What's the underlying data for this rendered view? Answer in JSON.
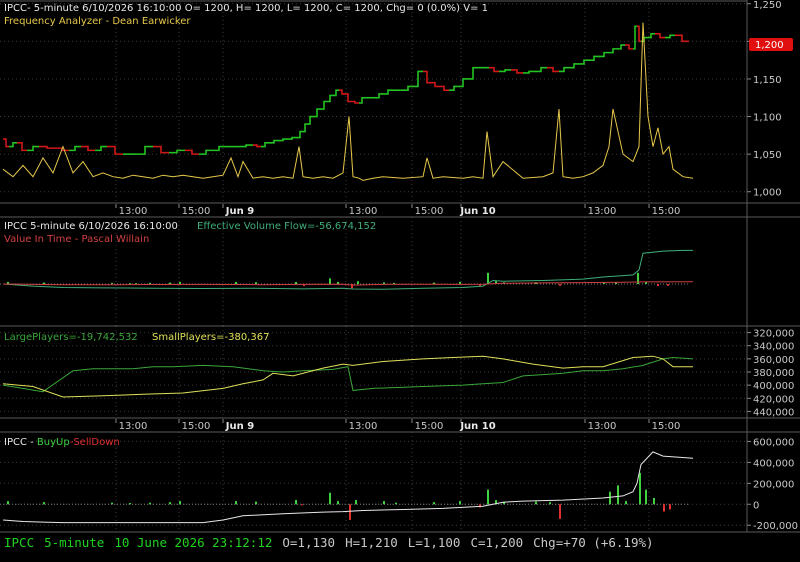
{
  "colors": {
    "background": "#000000",
    "grid": "#3a3a3a",
    "axis_text": "#c8c8c8",
    "up_candle": "#22c322",
    "down_candle": "#d01818",
    "frequency_line": "#e6c84a",
    "effective_volume_flow": "#3fae7a",
    "value_in_time": "#d04040",
    "large_players": "#3aa63a",
    "small_players": "#e0e05a",
    "buy_up": "#3fd43f",
    "sell_down": "#e03030",
    "white_line": "#e8e8e8",
    "status_green": "#1fd41f",
    "price_tag": "#e01010"
  },
  "panels": {
    "price": {
      "header": "IPCC- 5-minute 6/10/2026 16:10:00 O= 1200, H= 1200, L= 1200, C= 1200, Chg= 0 (0.0%) V= 1",
      "study": "Frequency Analyzer - Dean Earwicker",
      "price_tag": "1,200"
    },
    "volume": {
      "header": "IPCC 5-minute  6/10/2026 16:10:00",
      "study_label": "Effective Volume Flow=-56,674,152",
      "study2": "Value In Time - Pascal Willain"
    },
    "players": {
      "large_label": "LargePlayers=-19,742,532",
      "small_label": "SmallPlayers=-380,367"
    },
    "buyup": {
      "header": "IPCC - ",
      "buy_label": "BuyUp",
      "sep": "-",
      "sell_label": "SellDown"
    }
  },
  "time_axis_1": [
    "13:00",
    "15:00",
    "Jun 9",
    "13:00",
    "15:00",
    "Jun 10",
    "13:00",
    "15:00"
  ],
  "time_axis_2": [
    "13:00",
    "15:00",
    "Jun 9",
    "13:00",
    "15:00",
    "Jun 10",
    "13:00",
    "15:00"
  ],
  "status_bar": {
    "symbol": "IPCC",
    "interval": "5-minute",
    "datetime": "10 June 2026 23:12:12",
    "open": "O=1,130",
    "high": "H=1,210",
    "low": "L=1,100",
    "close": "C=1,200",
    "change": "Chg=+70 (+6.19%)"
  },
  "chart_data": [
    {
      "type": "line",
      "title": "Frequency Analyzer - Dean Earwicker",
      "ylim": [
        985,
        1255
      ],
      "y_ticks": [
        "1,000",
        "1,050",
        "1,100",
        "1,150",
        "1,200",
        "1,250"
      ],
      "y_tick_values": [
        1000,
        1050,
        1100,
        1150,
        1200,
        1250
      ],
      "series": [
        {
          "name": "IPCC",
          "x": [
            0,
            6,
            14,
            24,
            36,
            52,
            66,
            78,
            92,
            104,
            120,
            134,
            150,
            166,
            182,
            196,
            210,
            222,
            236,
            250,
            258,
            266,
            276,
            284,
            294,
            300,
            304,
            310,
            318,
            324,
            330,
            336,
            342,
            348,
            356,
            362,
            372,
            380,
            390,
            400,
            410,
            420,
            428,
            436,
            446,
            456,
            464,
            476,
            486,
            496,
            508,
            520,
            532,
            544,
            556,
            566,
            576,
            586,
            596,
            606,
            614,
            622,
            630,
            634,
            638,
            644,
            652,
            662,
            672,
            686
          ],
          "values": [
            1070,
            1060,
            1065,
            1055,
            1060,
            1058,
            1055,
            1060,
            1055,
            1060,
            1050,
            1050,
            1060,
            1052,
            1055,
            1050,
            1055,
            1060,
            1060,
            1062,
            1060,
            1065,
            1068,
            1070,
            1072,
            1080,
            1090,
            1100,
            1110,
            1120,
            1128,
            1135,
            1130,
            1120,
            1118,
            1125,
            1125,
            1130,
            1135,
            1135,
            1140,
            1160,
            1145,
            1140,
            1135,
            1140,
            1150,
            1165,
            1165,
            1160,
            1162,
            1158,
            1160,
            1165,
            1160,
            1165,
            1170,
            1175,
            1180,
            1185,
            1190,
            1195,
            1190,
            1220,
            1200,
            1205,
            1210,
            1205,
            1208,
            1200
          ]
        },
        {
          "name": "Frequency Analyzer",
          "x": [
            0,
            10,
            20,
            30,
            40,
            50,
            60,
            70,
            80,
            90,
            100,
            110,
            120,
            130,
            140,
            150,
            160,
            170,
            180,
            190,
            200,
            210,
            220,
            228,
            235,
            240,
            250,
            260,
            270,
            280,
            290,
            296,
            300,
            310,
            320,
            330,
            340,
            346,
            350,
            356,
            360,
            370,
            380,
            400,
            420,
            424,
            430,
            440,
            460,
            470,
            480,
            484,
            490,
            500,
            520,
            540,
            550,
            556,
            560,
            570,
            580,
            590,
            600,
            606,
            610,
            620,
            630,
            636,
            640,
            645,
            650,
            655,
            660,
            666,
            670,
            680,
            690
          ],
          "values": [
            1030,
            1020,
            1035,
            1020,
            1045,
            1025,
            1060,
            1025,
            1040,
            1020,
            1025,
            1020,
            1018,
            1022,
            1020,
            1018,
            1022,
            1020,
            1022,
            1020,
            1018,
            1020,
            1022,
            1045,
            1020,
            1040,
            1018,
            1020,
            1018,
            1020,
            1018,
            1060,
            1020,
            1018,
            1020,
            1018,
            1025,
            1100,
            1020,
            1018,
            1015,
            1018,
            1020,
            1018,
            1020,
            1045,
            1018,
            1020,
            1018,
            1020,
            1018,
            1080,
            1020,
            1040,
            1018,
            1020,
            1025,
            1110,
            1020,
            1018,
            1020,
            1025,
            1035,
            1060,
            1110,
            1050,
            1040,
            1060,
            1225,
            1100,
            1060,
            1085,
            1050,
            1060,
            1030,
            1020,
            1018
          ]
        }
      ]
    },
    {
      "type": "line",
      "title": "Effective Volume Flow / Value In Time",
      "series": [
        {
          "name": "Effective Volume Flow",
          "x": [
            0,
            30,
            60,
            100,
            150,
            200,
            250,
            300,
            340,
            350,
            380,
            420,
            460,
            480,
            490,
            500,
            540,
            580,
            600,
            620,
            630,
            636,
            640,
            660,
            680,
            690
          ],
          "values": [
            0.0,
            -1.5,
            -2.5,
            -2.8,
            -3.0,
            -3.2,
            -3.0,
            -3.5,
            -3.0,
            -3.6,
            -3.7,
            -3.0,
            -2.5,
            -1.5,
            2.5,
            2.0,
            2.5,
            3.5,
            5.0,
            6.0,
            6.5,
            10,
            22,
            23.5,
            24,
            24
          ]
        },
        {
          "name": "Value In Time",
          "x": [
            0,
            60,
            120,
            200,
            260,
            300,
            340,
            350,
            380,
            420,
            460,
            480,
            500,
            540,
            580,
            620,
            640,
            690
          ],
          "values": [
            0,
            -0.5,
            -0.5,
            -0.3,
            -0.5,
            -0.3,
            -0.2,
            -0.8,
            -0.3,
            -0.2,
            -0.3,
            -0.2,
            0.5,
            0.8,
            1.0,
            1.2,
            1.5,
            1.6
          ]
        }
      ],
      "bars": {
        "x": [
          4,
          40,
          108,
          126,
          132,
          146,
          166,
          176,
          232,
          252,
          292,
          300,
          326,
          334,
          348,
          354,
          380,
          390,
          430,
          456,
          476,
          484,
          492,
          500,
          532,
          556,
          600,
          612,
          634,
          642,
          654,
          664
        ],
        "values": [
          1.5,
          1.0,
          0.8,
          0.6,
          0.6,
          0.8,
          1.0,
          1.5,
          1.5,
          1.3,
          1.5,
          -1.5,
          4.0,
          1.5,
          -3.0,
          2.0,
          1.2,
          0.8,
          1.0,
          1.5,
          -1.5,
          8.0,
          2.0,
          1.2,
          1.3,
          -1.3,
          1.3,
          1.5,
          8.0,
          1.5,
          -1.5,
          -1.3
        ]
      }
    },
    {
      "type": "line",
      "title": "LargePlayers / SmallPlayers",
      "ylim": [
        450000,
        310000
      ],
      "y_ticks": [
        "320,000",
        "340,000",
        "360,000",
        "380,000",
        "400,000",
        "420,000",
        "440,000"
      ],
      "y_tick_values": [
        320000,
        340000,
        360000,
        380000,
        400000,
        420000,
        440000
      ],
      "series": [
        {
          "name": "LargePlayers",
          "x": [
            0,
            40,
            70,
            90,
            130,
            150,
            170,
            200,
            230,
            260,
            280,
            300,
            330,
            345,
            350,
            370,
            420,
            460,
            480,
            500,
            520,
            540,
            560,
            580,
            600,
            620,
            640,
            660,
            670,
            690
          ],
          "values": [
            400000,
            410000,
            378000,
            375000,
            375000,
            372000,
            372000,
            370000,
            372000,
            378000,
            380000,
            378000,
            376000,
            372000,
            408000,
            405000,
            402000,
            400000,
            398000,
            396000,
            386000,
            384000,
            382000,
            378000,
            378000,
            375000,
            370000,
            360000,
            358000,
            360000
          ]
        },
        {
          "name": "SmallPlayers",
          "x": [
            0,
            30,
            60,
            100,
            140,
            180,
            220,
            240,
            260,
            270,
            290,
            320,
            340,
            350,
            380,
            420,
            450,
            480,
            500,
            530,
            560,
            580,
            600,
            630,
            650,
            660,
            670,
            690
          ],
          "values": [
            398000,
            402000,
            418000,
            416000,
            414000,
            412000,
            405000,
            398000,
            392000,
            382000,
            386000,
            374000,
            368000,
            370000,
            364000,
            360000,
            358000,
            356000,
            360000,
            368000,
            374000,
            372000,
            372000,
            358000,
            356000,
            360000,
            372000,
            372000
          ]
        }
      ]
    },
    {
      "type": "bar",
      "title": "IPCC - BuyUp-SellDown",
      "ylim": [
        -265000,
        690000
      ],
      "y_ticks": [
        "600,000",
        "400,000",
        "200,000",
        "0",
        "-200,000"
      ],
      "y_tick_values": [
        600000,
        400000,
        200000,
        0,
        -200000
      ],
      "bars": {
        "x": [
          4,
          40,
          108,
          126,
          146,
          166,
          176,
          232,
          252,
          292,
          298,
          326,
          334,
          346,
          352,
          380,
          392,
          430,
          456,
          476,
          484,
          492,
          500,
          532,
          546,
          556,
          606,
          614,
          622,
          636,
          642,
          650,
          660,
          666
        ],
        "values": [
          30000,
          20000,
          15000,
          12000,
          15000,
          20000,
          30000,
          30000,
          25000,
          40000,
          -10000,
          110000,
          30000,
          -150000,
          40000,
          30000,
          15000,
          20000,
          30000,
          -30000,
          140000,
          40000,
          25000,
          25000,
          20000,
          -140000,
          120000,
          180000,
          30000,
          300000,
          140000,
          60000,
          -70000,
          -50000
        ]
      },
      "series": [
        {
          "name": "white line",
          "x": [
            0,
            20,
            40,
            60,
            80,
            120,
            160,
            200,
            220,
            240,
            280,
            320,
            340,
            360,
            400,
            440,
            480,
            500,
            520,
            560,
            600,
            620,
            630,
            634,
            638,
            650,
            660,
            690
          ],
          "values": [
            -150000,
            -165000,
            -170000,
            -175000,
            -175000,
            -175000,
            -175000,
            -175000,
            -150000,
            -110000,
            -90000,
            -75000,
            -70000,
            -60000,
            -50000,
            -40000,
            -20000,
            20000,
            30000,
            40000,
            60000,
            80000,
            120000,
            200000,
            380000,
            500000,
            460000,
            440000
          ]
        }
      ]
    }
  ]
}
